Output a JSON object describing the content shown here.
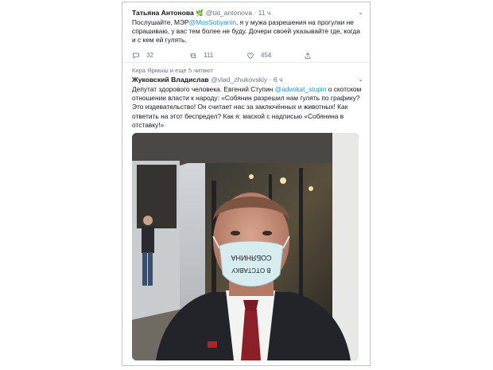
{
  "tweet1": {
    "name": "Татьяна Антонова",
    "handle": "@tat_antonova",
    "time": "· 11 ч",
    "text_1": "Послушайте, МЭР",
    "text_mention": "@MosSobyanin",
    "text_2": ", я у мужа разрешения на прогулки не спрашиваю, у вас тем более не буду. Дочери своей указывайте где, когда и с кем ей гулять.",
    "replies": "32",
    "retweets": "111",
    "likes": "454"
  },
  "tweet2": {
    "retweeted_by": "Кира Ярмыш и еще 5 читают",
    "name": "Жуковский Владислав",
    "handle": "@vlad_zhukovskiy",
    "time": "· 6 ч",
    "text_1": "Депутат здорового человека. Евгений Ступин ",
    "text_mention": "@advokat_stupin",
    "text_2": " о скотском отношении власти к народу: «Собянин разрешил нам гулять по графику? Это издевательство! Он считает нас за заключённых и животных! Как ответить на этот беспредел? Как я: маской с надписью «Собянина в отставку!»",
    "mask_line_1": "СОБЯНИНА",
    "mask_line_2": "В ОТСТАВКУ"
  },
  "colors": {
    "link": "#1b95e0",
    "muted": "#657786",
    "leaf": "#3aa04a"
  },
  "icons": [
    "chevron-down-icon",
    "leaf-icon",
    "reply-icon",
    "retweet-icon",
    "like-icon",
    "share-icon"
  ]
}
